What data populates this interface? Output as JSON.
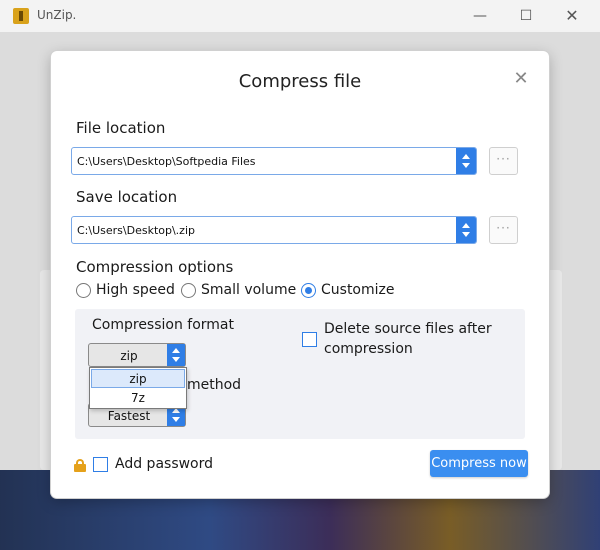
{
  "window": {
    "title": "UnZip.",
    "min": "—",
    "max": "☐",
    "close": "✕"
  },
  "dialog": {
    "title": "Compress file",
    "close": "✕",
    "file_location": {
      "label": "File location",
      "value": "C:\\Users\\Desktop\\Softpedia Files",
      "browse": "···"
    },
    "save_location": {
      "label": "Save location",
      "value": "C:\\Users\\Desktop\\.zip",
      "browse": "···"
    },
    "compression_options": {
      "label": "Compression options",
      "choices": [
        "High speed",
        "Small volume",
        "Customize"
      ],
      "selected": "Customize"
    },
    "format": {
      "label": "Compression format",
      "value": "zip",
      "options": [
        "zip",
        "7z"
      ],
      "highlighted": "zip"
    },
    "method": {
      "label_partial": "method",
      "value": "Fastest"
    },
    "delete_source": {
      "label_line1": "Delete source files after",
      "label_line2": "compression",
      "checked": false
    },
    "add_password": {
      "label": "Add password",
      "checked": false
    },
    "compress_button": "Compress now"
  },
  "colors": {
    "accent": "#2f7ee6",
    "button": "#3a8ef0",
    "lock": "#e5a11b"
  }
}
